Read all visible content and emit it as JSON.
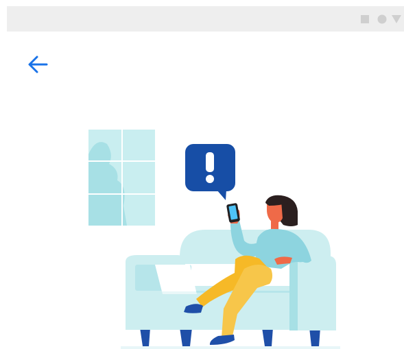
{
  "colors": {
    "accent": "#1a73e8",
    "status_bar": "#eeeeee",
    "alert_bubble": "#174ea6",
    "sofa": "#cdeef0",
    "sofa_shade": "#a7e0e5",
    "window": "#c9eef0",
    "legs": "#1f4fa8",
    "pants": "#f6b927",
    "sweater": "#8dd4df",
    "hair": "#2b1f1f",
    "skin": "#ef6a48"
  },
  "icons": {
    "status_bar": [
      "stop-square-icon",
      "home-circle-icon",
      "back-triangle-icon"
    ],
    "back": "arrow-left-icon",
    "alert": "exclamation-icon"
  }
}
